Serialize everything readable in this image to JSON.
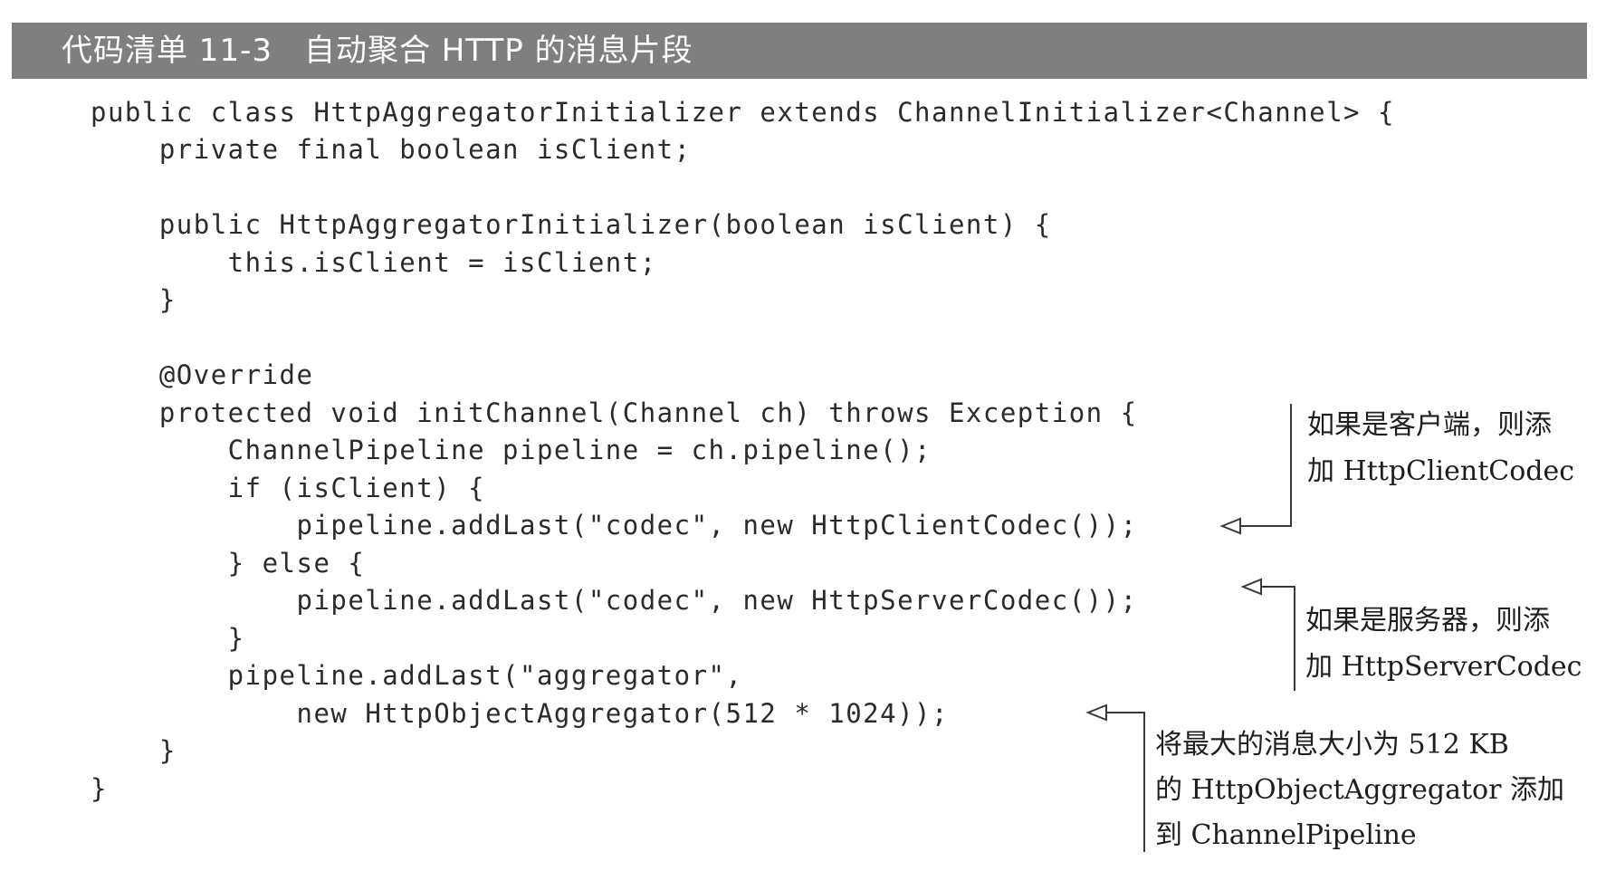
{
  "header": {
    "title": "代码清单 11-3　自动聚合 HTTP 的消息片段"
  },
  "code": {
    "lines": [
      "public class HttpAggregatorInitializer extends ChannelInitializer<Channel> {",
      "    private final boolean isClient;",
      "",
      "    public HttpAggregatorInitializer(boolean isClient) {",
      "        this.isClient = isClient;",
      "    }",
      "",
      "    @Override",
      "    protected void initChannel(Channel ch) throws Exception {",
      "        ChannelPipeline pipeline = ch.pipeline();",
      "        if (isClient) {",
      "            pipeline.addLast(\"codec\", new HttpClientCodec());",
      "        } else {",
      "            pipeline.addLast(\"codec\", new HttpServerCodec());",
      "        }",
      "        pipeline.addLast(\"aggregator\",",
      "            new HttpObjectAggregator(512 * 1024));",
      "    }",
      "}"
    ]
  },
  "annotations": {
    "client": [
      "如果是客户端，则添",
      "加 HttpClientCodec"
    ],
    "server": [
      "如果是服务器，则添",
      "加 HttpServerCodec"
    ],
    "aggregator": [
      "将最大的消息大小为 512 KB",
      "的 HttpObjectAggregator 添加",
      "到 ChannelPipeline"
    ]
  },
  "colors": {
    "header_background": "#7f7f7f",
    "header_text": "#ffffff",
    "code_text": "#2b2b2b",
    "callout_line": "#3a3a3a"
  }
}
